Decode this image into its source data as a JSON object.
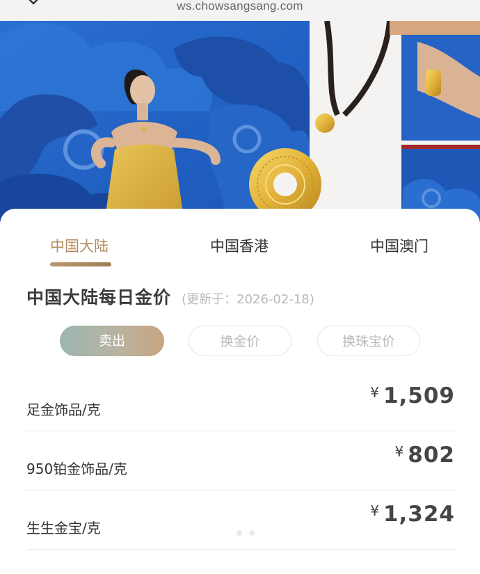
{
  "browser": {
    "url": "ws.chowsangsang.com"
  },
  "tabs": [
    {
      "label": "中国大陆",
      "active": true
    },
    {
      "label": "中国香港",
      "active": false
    },
    {
      "label": "中国澳门",
      "active": false
    }
  ],
  "heading": {
    "title": "中国大陆每日金价",
    "update_note": "(更新于：2026-02-18)"
  },
  "price_types": [
    {
      "label": "卖出",
      "active": true
    },
    {
      "label": "换金价",
      "active": false
    },
    {
      "label": "换珠宝价",
      "active": false
    }
  ],
  "prices": [
    {
      "label": "足金饰品/克",
      "currency": "¥",
      "amount": "1,509"
    },
    {
      "label": "950铂金饰品/克",
      "currency": "¥",
      "amount": "802"
    },
    {
      "label": "生生金宝/克",
      "currency": "¥",
      "amount": "1,324"
    }
  ],
  "colors": {
    "accent_gold": "#b38d5f",
    "banner_blue": "#1b5fc4",
    "gold_jewelry": "#e0b33c"
  },
  "icons": [
    "close-icon"
  ]
}
